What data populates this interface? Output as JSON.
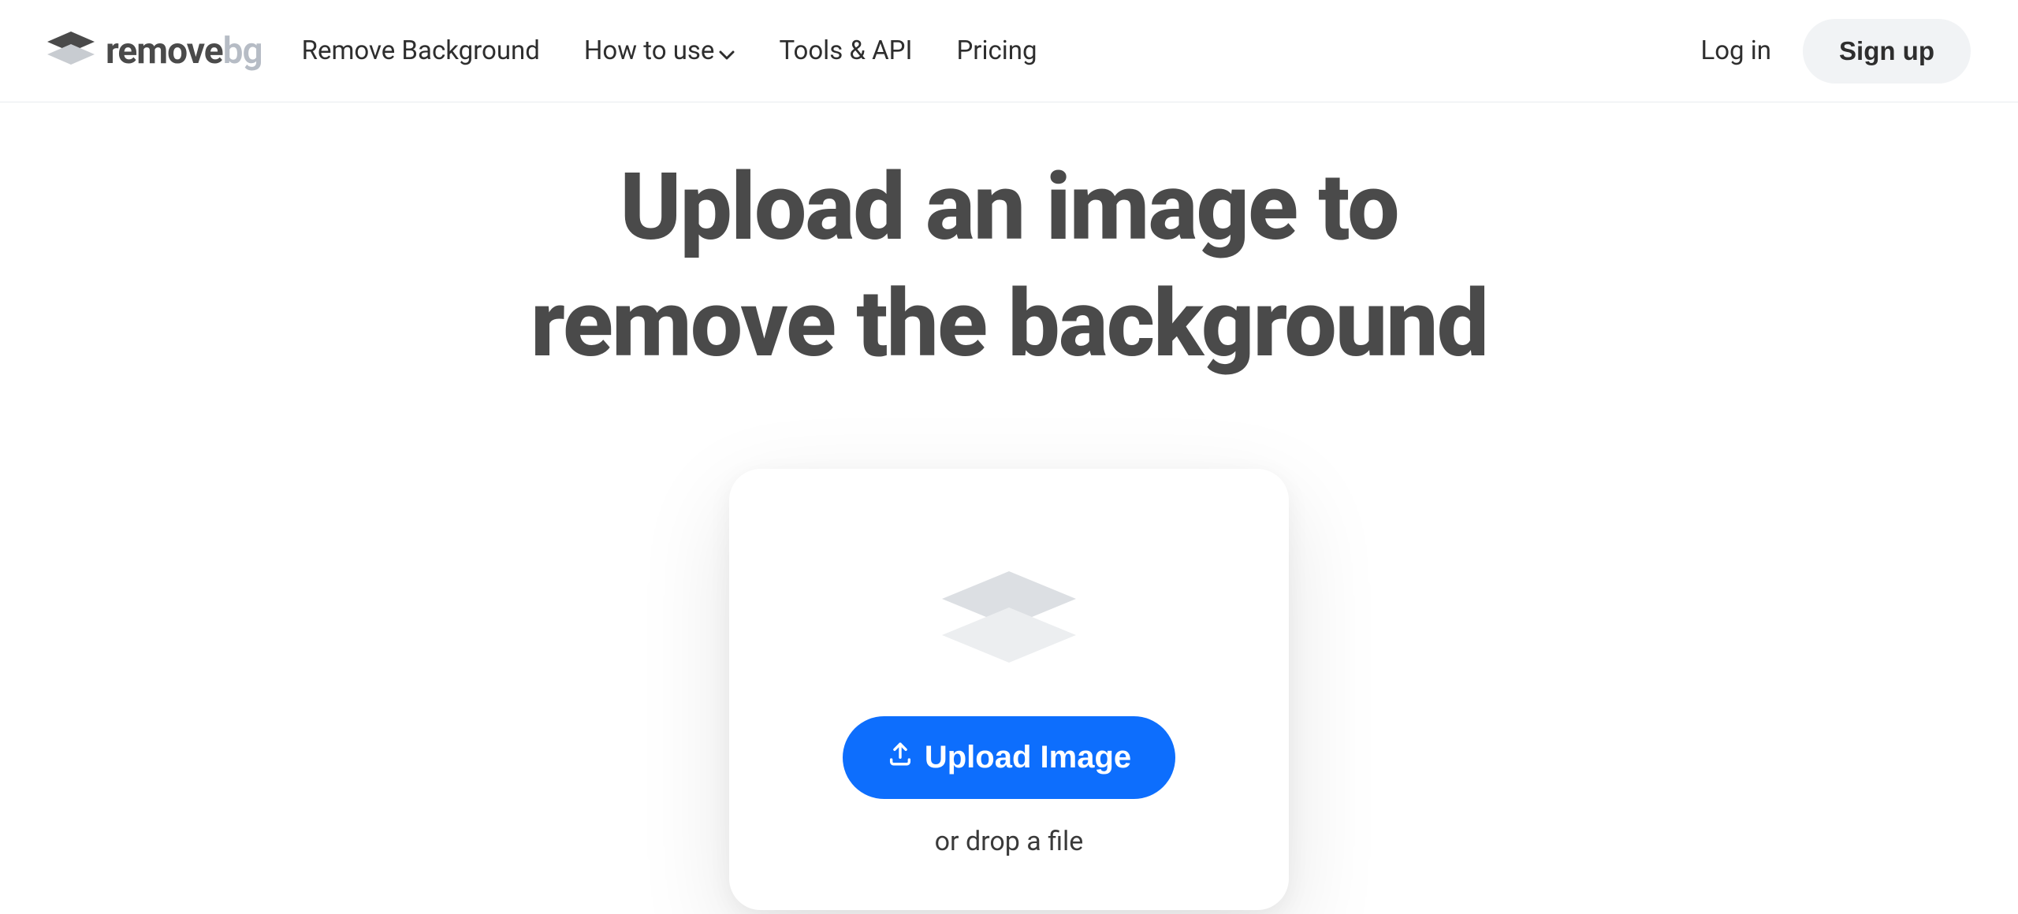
{
  "logo": {
    "word1": "remove",
    "word2": "bg"
  },
  "nav": {
    "items": [
      {
        "label": "Remove Background"
      },
      {
        "label": "How to use",
        "has_dropdown": true
      },
      {
        "label": "Tools & API"
      },
      {
        "label": "Pricing"
      }
    ],
    "login": "Log in",
    "signup": "Sign up"
  },
  "hero": {
    "line1": "Upload an image to",
    "line2": "remove the background"
  },
  "upload": {
    "button": "Upload Image",
    "drop_hint": "or drop a file"
  }
}
